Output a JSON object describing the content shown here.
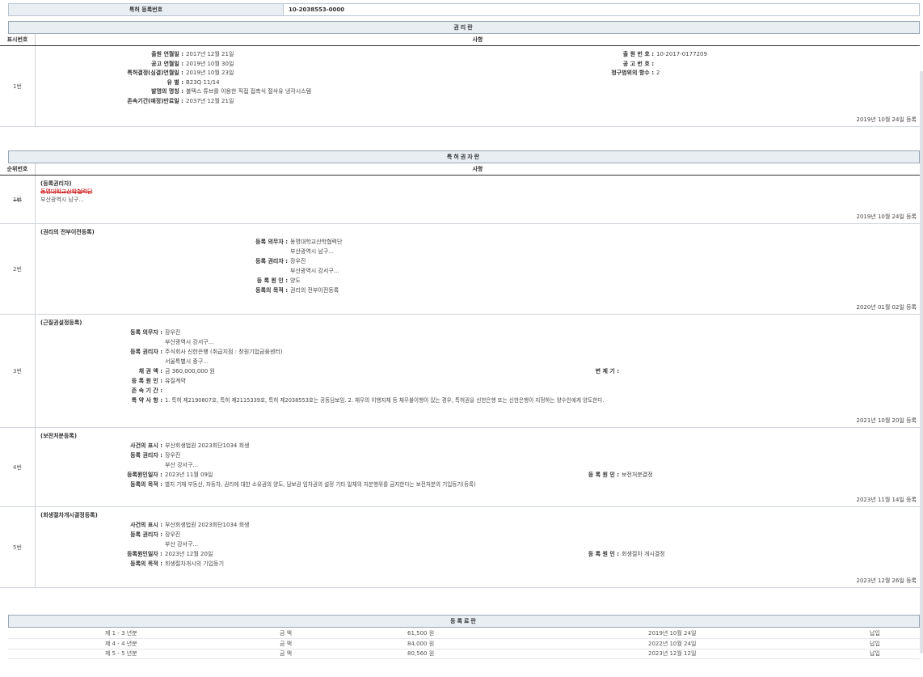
{
  "top": {
    "label": "특허 등록번호",
    "value": "10-2038553-0000"
  },
  "rights_section": {
    "title": "권리란",
    "col_no": "표시번호",
    "col_item": "사항",
    "row_no": "1번",
    "left_fields": [
      {
        "label": "출원 연월일 :",
        "value": "2017년 12월 21일"
      },
      {
        "label": "공고 연월일 :",
        "value": "2019년 10월 30일"
      },
      {
        "label": "특허결정(심결)연월일 :",
        "value": "2019년 10월 23일"
      },
      {
        "label": "유 별 :",
        "value": "B23Q 11/14"
      },
      {
        "label": "발명의 명칭 :",
        "value": "볼텍스 튜브를 이용한 직접 접촉식 절삭유 냉각시스템"
      },
      {
        "label": "존속기간(예정)만료일 :",
        "value": "2037년 12월 21일"
      }
    ],
    "right_fields": [
      {
        "label": "출 원 번 호 :",
        "value": "10-2017-0177209"
      },
      {
        "label": "공 고 번 호 :",
        "value": ""
      },
      {
        "label": "청구범위의 항수 :",
        "value": "2"
      }
    ],
    "stamp": "2019년 10월 24일 등록"
  },
  "holder_section": {
    "title": "특허권자란",
    "col_no": "순위번호",
    "col_item": "사항",
    "rows": [
      {
        "no": "1번",
        "type": "(등록권리자)",
        "name": "동명대학교산학협력단",
        "addr": "부산광역시 남구...",
        "stamp": "2019년 10월 24일 등록"
      },
      {
        "no": "2번",
        "type": "(권리의 전부이전등록)",
        "fields": [
          {
            "label": "등록 의무자 :",
            "value": "동명대학교산학협력단"
          },
          {
            "label": "",
            "value": "부산광역시 남구..."
          },
          {
            "label": "등록 권리자 :",
            "value": "장우진"
          },
          {
            "label": "",
            "value": "부산광역시 강서구..."
          },
          {
            "label": "등 록 원 인 :",
            "value": "양도"
          },
          {
            "label": "등록의 목적 :",
            "value": "권리의 전부이전등록"
          }
        ],
        "stamp": "2020년 01월 02일 등록"
      },
      {
        "no": "3번",
        "type": "(근질권설정등록)",
        "fields": [
          {
            "label": "등록 의무자 :",
            "value": "장우진"
          },
          {
            "label": "",
            "value": "부산광역시 강서구..."
          },
          {
            "label": "등록 권리자 :",
            "value": "주식회사 신한은행 (취급지점 : 창원기업금융센터)"
          },
          {
            "label": "",
            "value": "서울특별시 중구..."
          },
          {
            "label": "채 권 액 :",
            "value": "금 360,000,000 원"
          },
          {
            "label": "등 록 원 인 :",
            "value": "유질계약"
          },
          {
            "label": "존 속 기 간 :",
            "value": ""
          },
          {
            "label": "특 약 사 항 :",
            "value": "1. 특허 제2190807호, 특허 제2115339호, 특허 제2038553호는 공동담보임. 2. 채무의 이행지체 등 채무불이행이 있는 경우, 특허권을 신한은행 또는 신한은행이 지정하는 양수인에게 양도한다."
          }
        ],
        "right_label": "변 제 기 :",
        "stamp": "2021년 10월 20일 등록"
      },
      {
        "no": "4번",
        "type": "(보전처분등록)",
        "fields": [
          {
            "label": "사건의 표시 :",
            "value": "부산회생법원 2023회단1034 회생"
          },
          {
            "label": "등록 권리자 :",
            "value": "장우진"
          },
          {
            "label": "",
            "value": "부산 강서구..."
          },
          {
            "label": "등록원인일자 :",
            "value": "2023년 11월 09일"
          },
          {
            "label": "등록의 목적 :",
            "value": "별지 기재 부동산, 자동차, 권리에 대한 소유권의 양도, 담보권 임차권의 설정 기타 일체의 처분행위를 금지한다는 보전처분의 기입등기(등록)"
          }
        ],
        "right_label": "등 록 원 인 :",
        "right_value": "보전처분결정",
        "stamp": "2023년 11월 14일 등록"
      },
      {
        "no": "5번",
        "type": "(회생절차개시결정등록)",
        "fields": [
          {
            "label": "사건의 표시 :",
            "value": "부산회생법원 2023회단1034 회생"
          },
          {
            "label": "등록 권리자 :",
            "value": "장우진"
          },
          {
            "label": "",
            "value": "부산 강서구..."
          },
          {
            "label": "등록원인일자 :",
            "value": "2023년 12월 20일"
          },
          {
            "label": "등록의 목적 :",
            "value": "회생절차개시의 기입등기"
          }
        ],
        "right_label": "등 록 원 인 :",
        "right_value": "회생절차 개시결정",
        "stamp": "2023년 12월 26일 등록"
      }
    ]
  },
  "fee_section": {
    "title": "등록료란",
    "rows": [
      {
        "period": "제 1 - 3 년분",
        "label": "금 액",
        "amount": "61,500 원",
        "date": "2019년 10월 24일",
        "status": "납입"
      },
      {
        "period": "제 4 - 4 년분",
        "label": "금 액",
        "amount": "84,000 원",
        "date": "2022년 10월 24일",
        "status": "납입"
      },
      {
        "period": "제 5 - 5 년분",
        "label": "금 액",
        "amount": "80,560 원",
        "date": "2023년 12월 12일",
        "status": "납입"
      }
    ]
  }
}
